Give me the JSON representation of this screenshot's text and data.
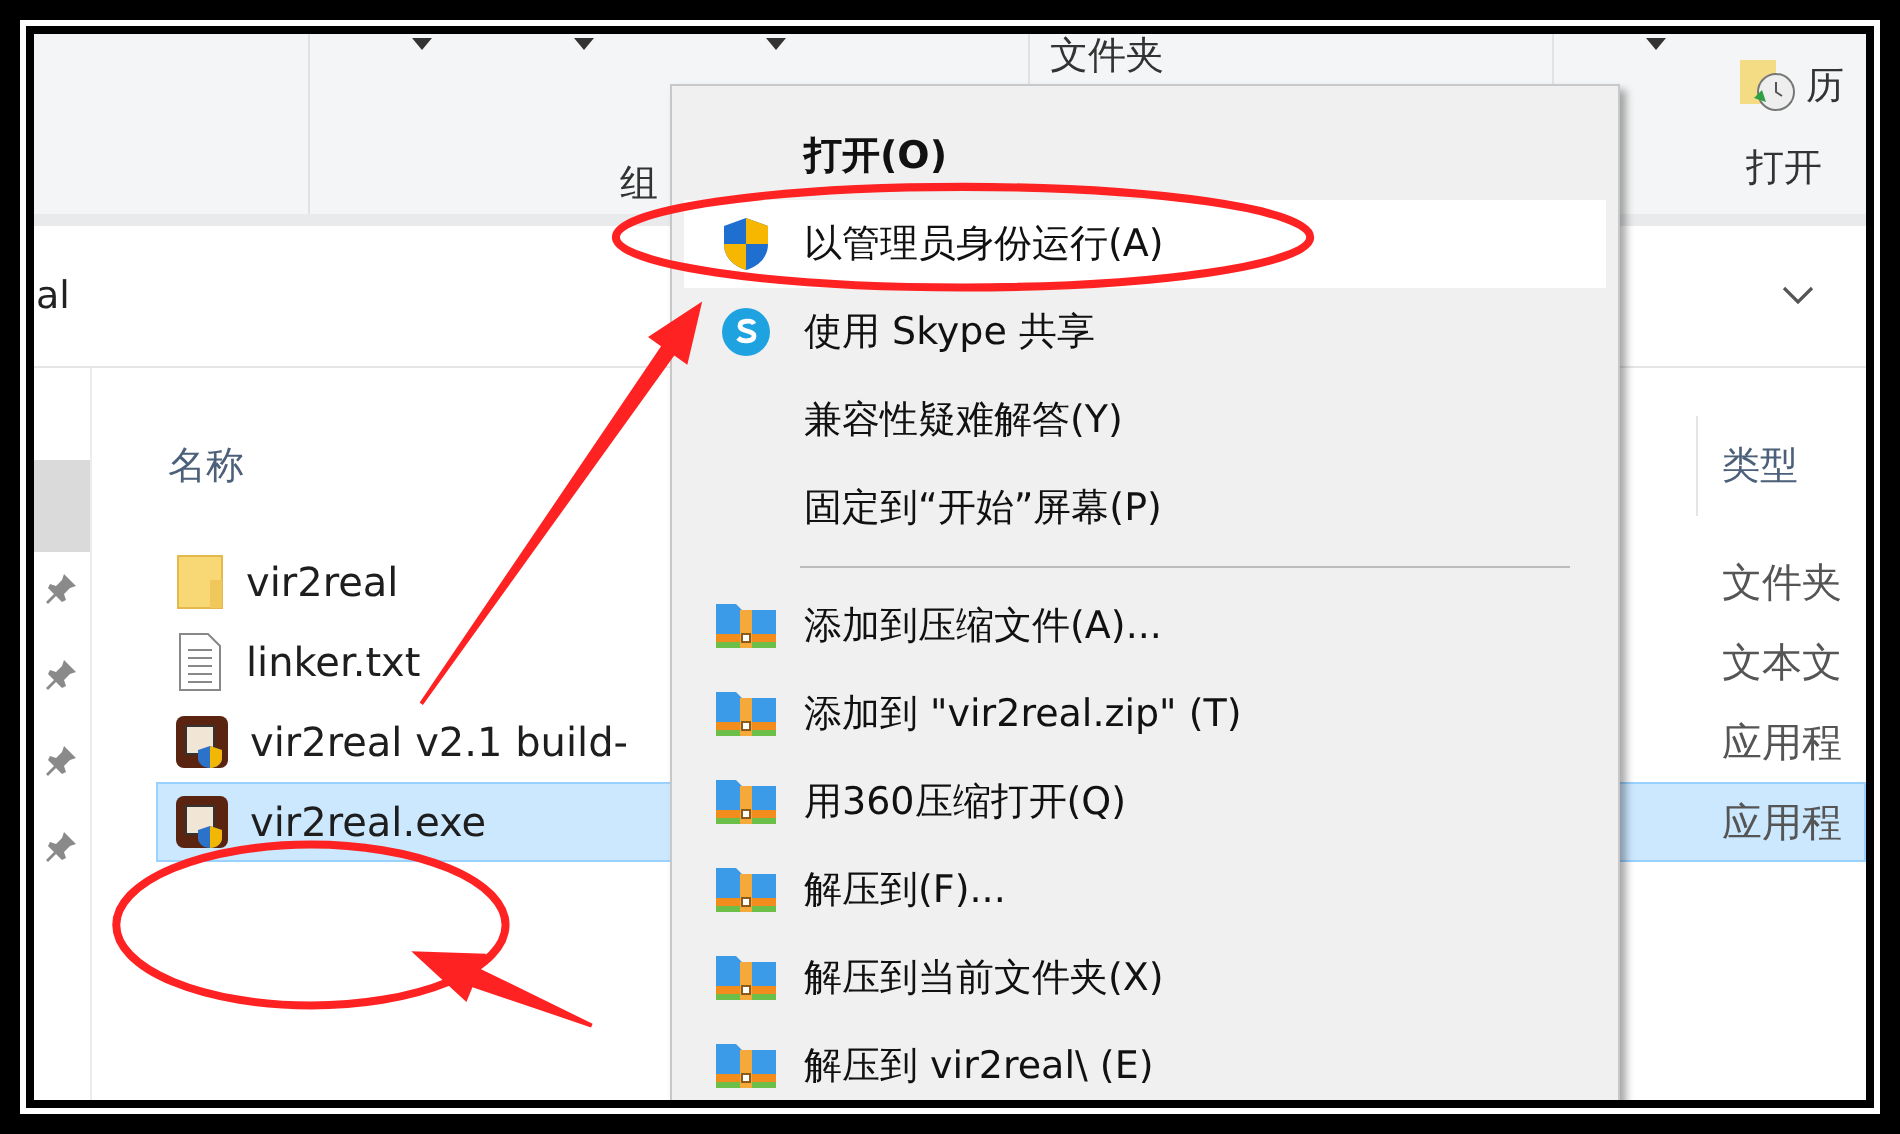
{
  "ribbon": {
    "group_labels": [
      {
        "text": "组"
      },
      {
        "text": "文件夹"
      },
      {
        "text": "历"
      },
      {
        "text": "打开"
      }
    ]
  },
  "address_bar": {
    "text": "al"
  },
  "file_list": {
    "columns": [
      "名称",
      "类型"
    ],
    "rows": [
      {
        "name": "vir2real",
        "type": "文件夹",
        "kind": "folder",
        "selected": false
      },
      {
        "name": "linker.txt",
        "type": "文本文",
        "kind": "text",
        "selected": false
      },
      {
        "name": "vir2real v2.1 build-",
        "type": "应用程",
        "kind": "app",
        "selected": false
      },
      {
        "name": "vir2real.exe",
        "type": "应用程",
        "kind": "app",
        "selected": true
      }
    ]
  },
  "context_menu": {
    "items": [
      {
        "kind": "plain",
        "label": "打开(O)",
        "bold": true,
        "selected": false
      },
      {
        "kind": "shield",
        "label": "以管理员身份运行(A)",
        "bold": false,
        "selected": true
      },
      {
        "kind": "skype",
        "label": "使用 Skype 共享",
        "bold": false,
        "selected": false
      },
      {
        "kind": "plain",
        "label": "兼容性疑难解答(Y)",
        "bold": false,
        "selected": false
      },
      {
        "kind": "plain",
        "label": "固定到“开始”屏幕(P)",
        "bold": false,
        "selected": false
      },
      {
        "kind": "separator"
      },
      {
        "kind": "archive",
        "label": "添加到压缩文件(A)...",
        "bold": false,
        "selected": false
      },
      {
        "kind": "archive",
        "label": "添加到 \"vir2real.zip\" (T)",
        "bold": false,
        "selected": false
      },
      {
        "kind": "archive",
        "label": "用360压缩打开(Q)",
        "bold": false,
        "selected": false
      },
      {
        "kind": "archive",
        "label": "解压到(F)...",
        "bold": false,
        "selected": false
      },
      {
        "kind": "archive",
        "label": "解压到当前文件夹(X)",
        "bold": false,
        "selected": false
      },
      {
        "kind": "archive",
        "label": "解压到 vir2real\\ (E)",
        "bold": false,
        "selected": false
      }
    ]
  }
}
